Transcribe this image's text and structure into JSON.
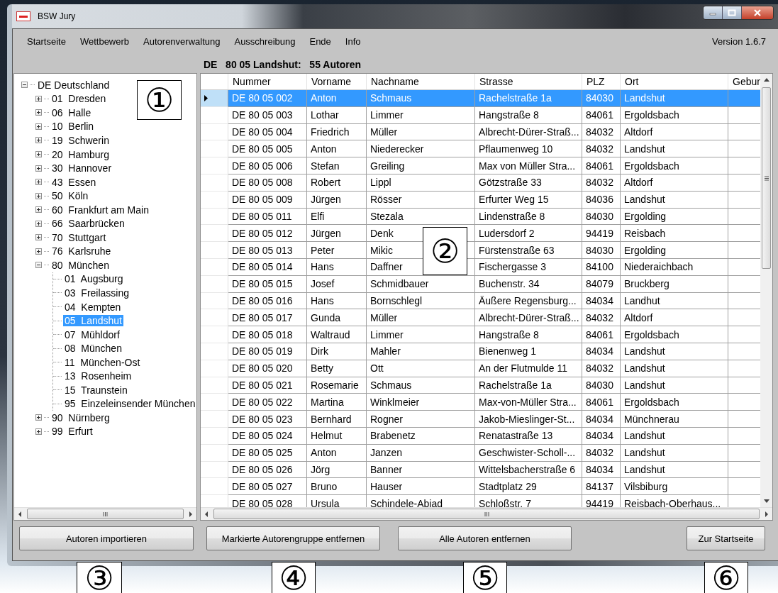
{
  "window": {
    "title": "BSW Jury"
  },
  "menu": [
    {
      "label": "Startseite"
    },
    {
      "label": "Wettbewerb"
    },
    {
      "label": "Autorenverwaltung"
    },
    {
      "label": "Ausschreibung"
    },
    {
      "label": "Ende"
    },
    {
      "label": "Info"
    }
  ],
  "version": "Version 1.6.7",
  "group_heading": "DE   80 05 Landshut:   55 Autoren",
  "tree": [
    {
      "label": "DE Deutschland",
      "expanded": true,
      "selected": false,
      "children": [
        {
          "label": "01  Dresden",
          "expanded": false,
          "selected": false
        },
        {
          "label": "06  Halle",
          "expanded": false,
          "selected": false
        },
        {
          "label": "10  Berlin",
          "expanded": false,
          "selected": false
        },
        {
          "label": "19  Schwerin",
          "expanded": false,
          "selected": false
        },
        {
          "label": "20  Hamburg",
          "expanded": false,
          "selected": false
        },
        {
          "label": "30  Hannover",
          "expanded": false,
          "selected": false
        },
        {
          "label": "43  Essen",
          "expanded": false,
          "selected": false
        },
        {
          "label": "50  Köln",
          "expanded": false,
          "selected": false
        },
        {
          "label": "60  Frankfurt am Main",
          "expanded": false,
          "selected": false
        },
        {
          "label": "66  Saarbrücken",
          "expanded": false,
          "selected": false
        },
        {
          "label": "70  Stuttgart",
          "expanded": false,
          "selected": false
        },
        {
          "label": "76  Karlsruhe",
          "expanded": false,
          "selected": false
        },
        {
          "label": "80  München",
          "expanded": true,
          "selected": false,
          "children": [
            {
              "label": "01  Augsburg",
              "selected": false
            },
            {
              "label": "03  Freilassing",
              "selected": false
            },
            {
              "label": "04  Kempten",
              "selected": false
            },
            {
              "label": "05  Landshut",
              "selected": true
            },
            {
              "label": "07  Mühldorf",
              "selected": false
            },
            {
              "label": "08  München",
              "selected": false
            },
            {
              "label": "11  München-Ost",
              "selected": false
            },
            {
              "label": "13  Rosenheim",
              "selected": false
            },
            {
              "label": "15  Traunstein",
              "selected": false
            },
            {
              "label": "95  Einzeleinsender München",
              "selected": false
            }
          ]
        },
        {
          "label": "90  Nürnberg",
          "expanded": false,
          "selected": false
        },
        {
          "label": "99  Erfurt",
          "expanded": false,
          "selected": false
        }
      ]
    }
  ],
  "table": {
    "columns": [
      "Nummer",
      "Vorname",
      "Nachname",
      "Strasse",
      "PLZ",
      "Ort",
      "Gebur"
    ],
    "rows": [
      {
        "selected": true,
        "cells": [
          "DE 80 05 002",
          "Anton",
          "Schmaus",
          "Rachelstraße 1a",
          "84030",
          "Landshut"
        ]
      },
      {
        "selected": false,
        "cells": [
          "DE 80 05 003",
          "Lothar",
          "Limmer",
          "Hangstraße 8",
          "84061",
          "Ergoldsbach"
        ]
      },
      {
        "selected": false,
        "cells": [
          "DE 80 05 004",
          "Friedrich",
          "Müller",
          "Albrecht-Dürer-Straß...",
          "84032",
          "Altdorf"
        ]
      },
      {
        "selected": false,
        "cells": [
          "DE 80 05 005",
          "Anton",
          "Niederecker",
          "Pflaumenweg 10",
          "84032",
          "Landshut"
        ]
      },
      {
        "selected": false,
        "cells": [
          "DE 80 05 006",
          "Stefan",
          "Greiling",
          "Max von Müller Stra...",
          "84061",
          "Ergoldsbach"
        ]
      },
      {
        "selected": false,
        "cells": [
          "DE 80 05 008",
          "Robert",
          "Lippl",
          "Götzstraße 33",
          "84032",
          "Altdorf"
        ]
      },
      {
        "selected": false,
        "cells": [
          "DE 80 05 009",
          "Jürgen",
          "Rösser",
          "Erfurter Weg 15",
          "84036",
          "Landshut"
        ]
      },
      {
        "selected": false,
        "cells": [
          "DE 80 05 011",
          "Elfi",
          "Stezala",
          "Lindenstraße 8",
          "84030",
          "Ergolding"
        ]
      },
      {
        "selected": false,
        "cells": [
          "DE 80 05 012",
          "Jürgen",
          "Denk",
          "Ludersdorf 2",
          "94419",
          "Reisbach"
        ]
      },
      {
        "selected": false,
        "cells": [
          "DE 80 05 013",
          "Peter",
          "Mikic",
          "Fürstenstraße 63",
          "84030",
          "Ergolding"
        ]
      },
      {
        "selected": false,
        "cells": [
          "DE 80 05 014",
          "Hans",
          "Daffner",
          "Fischergasse 3",
          "84100",
          "Niederaichbach"
        ]
      },
      {
        "selected": false,
        "cells": [
          "DE 80 05 015",
          "Josef",
          "Schmidbauer",
          "Buchenstr. 34",
          "84079",
          "Bruckberg"
        ]
      },
      {
        "selected": false,
        "cells": [
          "DE 80 05 016",
          "Hans",
          "Bornschlegl",
          "Äußere Regensburg...",
          "84034",
          "Landhut"
        ]
      },
      {
        "selected": false,
        "cells": [
          "DE 80 05 017",
          "Gunda",
          "Müller",
          "Albrecht-Dürer-Straß...",
          "84032",
          "Altdorf"
        ]
      },
      {
        "selected": false,
        "cells": [
          "DE 80 05 018",
          "Waltraud",
          "Limmer",
          "Hangstraße 8",
          "84061",
          "Ergoldsbach"
        ]
      },
      {
        "selected": false,
        "cells": [
          "DE 80 05 019",
          "Dirk",
          "Mahler",
          "Bienenweg 1",
          "84034",
          "Landshut"
        ]
      },
      {
        "selected": false,
        "cells": [
          "DE 80 05 020",
          "Betty",
          "Ott",
          "An der Flutmulde 11",
          "84032",
          "Landshut"
        ]
      },
      {
        "selected": false,
        "cells": [
          "DE 80 05 021",
          "Rosemarie",
          "Schmaus",
          "Rachelstraße 1a",
          "84030",
          "Landshut"
        ]
      },
      {
        "selected": false,
        "cells": [
          "DE 80 05 022",
          "Martina",
          "Winklmeier",
          "Max-von-Müller Stra...",
          "84061",
          "Ergoldsbach"
        ]
      },
      {
        "selected": false,
        "cells": [
          "DE 80 05 023",
          "Bernhard",
          "Rogner",
          "Jakob-Mieslinger-St...",
          "84034",
          "Münchnerau"
        ]
      },
      {
        "selected": false,
        "cells": [
          "DE 80 05 024",
          "Helmut",
          "Brabenetz",
          "Renatastraße 13",
          "84034",
          "Landshut"
        ]
      },
      {
        "selected": false,
        "cells": [
          "DE 80 05 025",
          "Anton",
          "Janzen",
          "Geschwister-Scholl-...",
          "84032",
          "Landshut"
        ]
      },
      {
        "selected": false,
        "cells": [
          "DE 80 05 026",
          "Jörg",
          "Banner",
          "Wittelsbacherstraße 6",
          "84034",
          "Landshut"
        ]
      },
      {
        "selected": false,
        "cells": [
          "DE 80 05 027",
          "Bruno",
          "Hauser",
          "Stadtplatz 29",
          "84137",
          "Vilsbiburg"
        ]
      },
      {
        "selected": false,
        "cells": [
          "DE 80 05 028",
          "Ursula",
          "Schindele-Abiad",
          "Schloßstr. 7",
          "94419",
          "Reisbach-Oberhaus..."
        ]
      }
    ]
  },
  "buttons": [
    {
      "label": "Autoren importieren"
    },
    {
      "label": "Markierte Autorengruppe entfernen"
    },
    {
      "label": "Alle Autoren entfernen"
    },
    {
      "label": "Zur Startseite"
    }
  ],
  "callouts": [
    {
      "label": "①"
    },
    {
      "label": "②"
    },
    {
      "label": "③"
    },
    {
      "label": "④"
    },
    {
      "label": "⑤"
    },
    {
      "label": "⑥"
    }
  ]
}
